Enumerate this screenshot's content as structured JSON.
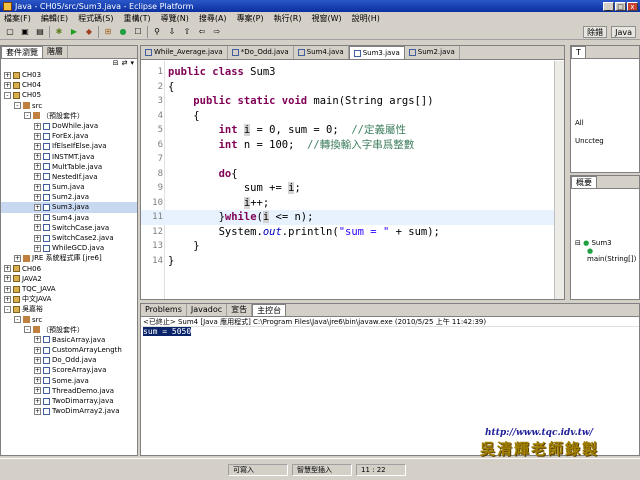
{
  "window": {
    "title": "Java - CH05/src/Sum3.java - Eclipse Platform",
    "min": "_",
    "max": "□",
    "close": "x"
  },
  "menu": [
    "檔案(F)",
    "編輯(E)",
    "程式碼(S)",
    "重構(T)",
    "導覽(N)",
    "搜尋(A)",
    "專案(P)",
    "執行(R)",
    "視窗(W)",
    "說明(H)"
  ],
  "perspectives": {
    "debug": "除錯",
    "java": "Java"
  },
  "explorer": {
    "tabs": [
      "套件瀏覽",
      "階層"
    ],
    "tree": [
      {
        "label": "CH03",
        "kind": "proj",
        "depth": 0,
        "exp": "+"
      },
      {
        "label": "CH04",
        "kind": "proj",
        "depth": 0,
        "exp": "+"
      },
      {
        "label": "CH05",
        "kind": "proj",
        "depth": 0,
        "exp": "-"
      },
      {
        "label": "src",
        "kind": "pkg",
        "depth": 1,
        "exp": "-"
      },
      {
        "label": "（預設套件）",
        "kind": "pkg",
        "depth": 2,
        "exp": "-"
      },
      {
        "label": "DoWhile.java",
        "kind": "java",
        "depth": 3,
        "exp": "+"
      },
      {
        "label": "ForEx.java",
        "kind": "java",
        "depth": 3,
        "exp": "+"
      },
      {
        "label": "IfElseIfElse.java",
        "kind": "java",
        "depth": 3,
        "exp": "+"
      },
      {
        "label": "INSTMT.java",
        "kind": "java",
        "depth": 3,
        "exp": "+"
      },
      {
        "label": "MultTable.java",
        "kind": "java",
        "depth": 3,
        "exp": "+"
      },
      {
        "label": "NestedIf.java",
        "kind": "java",
        "depth": 3,
        "exp": "+"
      },
      {
        "label": "Sum.java",
        "kind": "java",
        "depth": 3,
        "exp": "+"
      },
      {
        "label": "Sum2.java",
        "kind": "java",
        "depth": 3,
        "exp": "+"
      },
      {
        "label": "Sum3.java",
        "kind": "java",
        "depth": 3,
        "exp": "+",
        "selected": true
      },
      {
        "label": "Sum4.java",
        "kind": "java",
        "depth": 3,
        "exp": "+"
      },
      {
        "label": "SwitchCase.java",
        "kind": "java",
        "depth": 3,
        "exp": "+"
      },
      {
        "label": "SwitchCase2.java",
        "kind": "java",
        "depth": 3,
        "exp": "+"
      },
      {
        "label": "WhileGCD.java",
        "kind": "java",
        "depth": 3,
        "exp": "+"
      },
      {
        "label": "JRE 系統程式庫 [jre6]",
        "kind": "pkg",
        "depth": 1,
        "exp": "+"
      },
      {
        "label": "CH06",
        "kind": "proj",
        "depth": 0,
        "exp": "+"
      },
      {
        "label": "JAVA2",
        "kind": "proj",
        "depth": 0,
        "exp": "+"
      },
      {
        "label": "TQC_JAVA",
        "kind": "proj",
        "depth": 0,
        "exp": "+"
      },
      {
        "label": "中文JAVA",
        "kind": "proj",
        "depth": 0,
        "exp": "+"
      },
      {
        "label": "吳嘉裕",
        "kind": "proj",
        "depth": 0,
        "exp": "-"
      },
      {
        "label": "src",
        "kind": "pkg",
        "depth": 1,
        "exp": "-"
      },
      {
        "label": "（預設套件）",
        "kind": "pkg",
        "depth": 2,
        "exp": "-"
      },
      {
        "label": "BasicArray.java",
        "kind": "java",
        "depth": 3,
        "exp": "+"
      },
      {
        "label": "CustomArrayLength",
        "kind": "java",
        "depth": 3,
        "exp": "+"
      },
      {
        "label": "Do_Odd.java",
        "kind": "java",
        "depth": 3,
        "exp": "+"
      },
      {
        "label": "ScoreArray.java",
        "kind": "java",
        "depth": 3,
        "exp": "+"
      },
      {
        "label": "Some.java",
        "kind": "java",
        "depth": 3,
        "exp": "+"
      },
      {
        "label": "ThreadDemo.java",
        "kind": "java",
        "depth": 3,
        "exp": "+"
      },
      {
        "label": "TwoDimarray.java",
        "kind": "java",
        "depth": 3,
        "exp": "+"
      },
      {
        "label": "TwoDimArray2.java",
        "kind": "java",
        "depth": 3,
        "exp": "+"
      }
    ]
  },
  "editor": {
    "tabs": [
      {
        "label": "While_Average.java",
        "active": false
      },
      {
        "label": "*Do_Odd.java",
        "active": false
      },
      {
        "label": "Sum4.java",
        "active": false
      },
      {
        "label": "Sum3.java",
        "active": true
      },
      {
        "label": "Sum2.java",
        "active": false
      }
    ],
    "lines": [
      {
        "n": "1",
        "html": "<span class='kw'>public class</span> Sum3"
      },
      {
        "n": "2",
        "html": "{"
      },
      {
        "n": "3",
        "html": "    <span class='kw'>public static void</span> main(String args[])"
      },
      {
        "n": "4",
        "html": "    {"
      },
      {
        "n": "5",
        "html": "        <span class='kw'>int</span> <span class='hl'>i</span> = 0, sum = 0;  <span class='cm'>//定義屬性</span>"
      },
      {
        "n": "6",
        "html": "        <span class='kw'>int</span> n = 100;  <span class='cm'>//轉換輸入字串爲整數</span>"
      },
      {
        "n": "7",
        "html": ""
      },
      {
        "n": "8",
        "html": "        <span class='kw'>do</span>{"
      },
      {
        "n": "9",
        "html": "            sum += <span class='hl'>i</span>;"
      },
      {
        "n": "10",
        "html": "            <span class='hl'>i</span>++;"
      },
      {
        "n": "11",
        "html": "        }<span class='kw'>while</span>(<span class='hl'>i</span> &lt;= n);",
        "current": true
      },
      {
        "n": "12",
        "html": "        System.<span class='fl'>out</span>.println(<span class='st'>\"sum = \"</span> + sum);"
      },
      {
        "n": "13",
        "html": "    }"
      },
      {
        "n": "14",
        "html": "}"
      }
    ]
  },
  "console": {
    "tabs": [
      "Problems",
      "Javadoc",
      "宣告",
      "主控台"
    ],
    "header": "<已終止> Sum4 [Java 應用程式] C:\\Program Files\\Java\\jre6\\bin\\javaw.exe (2010/5/25 上午 11:42:39)",
    "output": "sum = 5050"
  },
  "right": {
    "top_tabs": [
      "T"
    ],
    "top_text": [
      "All",
      "Unccteg"
    ],
    "outline_tab": "概要",
    "outline_items": [
      "Sum3",
      "main(String[])"
    ]
  },
  "status": {
    "writable": "可寫入",
    "insert": "智慧型插入",
    "position": "11 : 22"
  },
  "watermark": {
    "url": "http://www.tqc.idv.tw/"
  }
}
